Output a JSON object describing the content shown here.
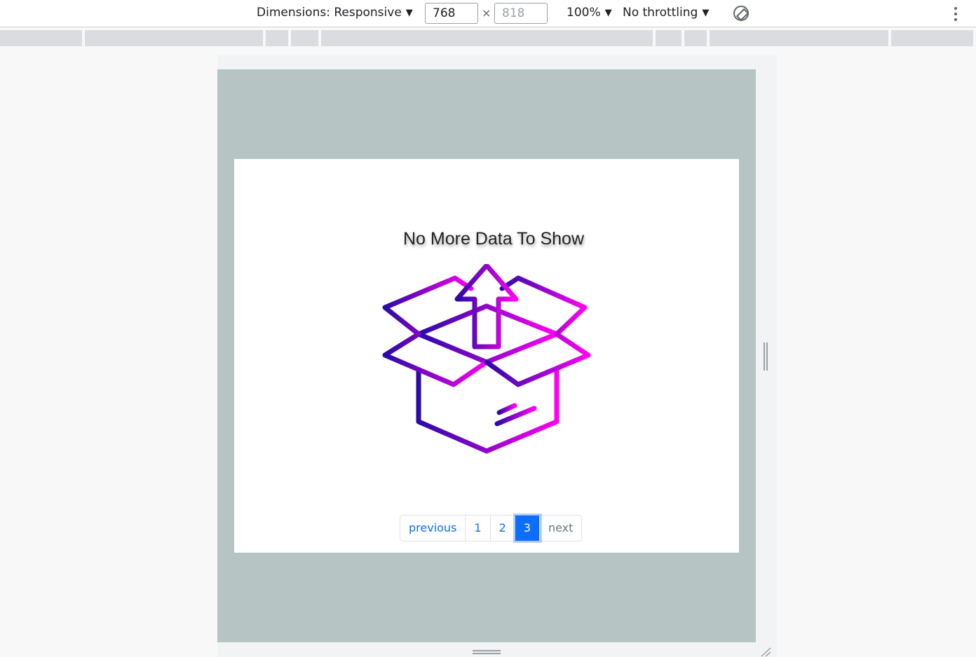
{
  "toolbar": {
    "dimensions_label": "Dimensions: Responsive",
    "width_value": "768",
    "height_placeholder": "818",
    "times": "×",
    "zoom_label": "100%",
    "throttling_label": "No throttling",
    "caret": "▼"
  },
  "page": {
    "empty_title": "No More Data To Show",
    "gradient": {
      "start": "#2a0aa8",
      "end": "#ff00f0"
    }
  },
  "pagination": {
    "previous": "previous",
    "pages": [
      "1",
      "2",
      "3"
    ],
    "active_page": "3",
    "next": "next"
  },
  "colors": {
    "viewport_bg": "#b7c4c4",
    "accent": "#0d6efd"
  }
}
